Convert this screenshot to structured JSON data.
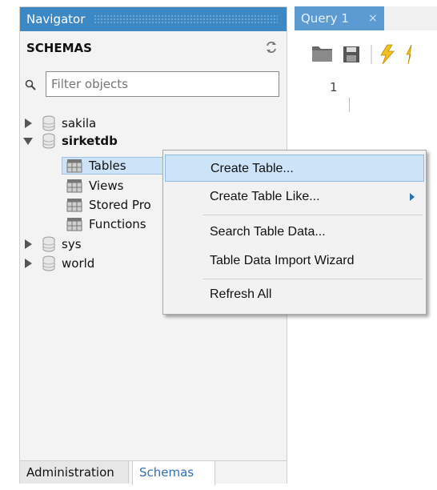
{
  "navigator": {
    "title": "Navigator",
    "schemas_label": "SCHEMAS",
    "filter_placeholder": "Filter objects",
    "tree": {
      "sakila": "sakila",
      "sirketdb": "sirketdb",
      "tables": "Tables",
      "views": "Views",
      "stored_procedures": "Stored Pro",
      "functions": "Functions",
      "sys": "sys",
      "world": "world"
    },
    "tabs": {
      "administration": "Administration",
      "schemas": "Schemas"
    }
  },
  "query": {
    "tab_label": "Query 1",
    "close_glyph": "×",
    "line_number": "1"
  },
  "context_menu": {
    "items": [
      {
        "label": "Create Table..."
      },
      {
        "label": "Create Table Like..."
      },
      {
        "label": "Search Table Data..."
      },
      {
        "label": "Table Data Import Wizard"
      },
      {
        "label": "Refresh All"
      }
    ]
  },
  "colors": {
    "header_blue": "#3c88c5",
    "selection": "#cde3f7",
    "link_blue": "#2f6fb6"
  },
  "icons": {
    "refresh": "refresh-icon",
    "filter": "search-icon",
    "database": "database-icon",
    "table": "table-icon",
    "open_folder": "folder-icon",
    "save": "save-icon",
    "execute": "lightning-icon"
  }
}
